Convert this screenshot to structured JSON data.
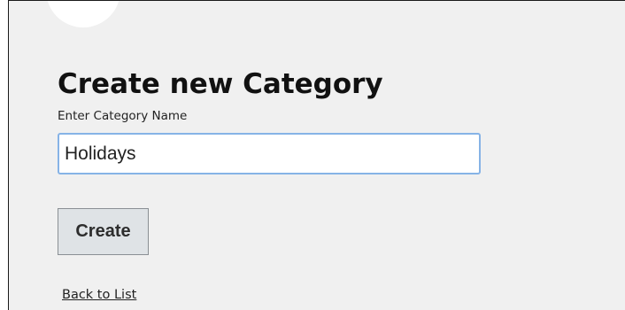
{
  "form": {
    "title": "Create new Category",
    "name_label": "Enter Category Name",
    "name_value": "Holidays",
    "create_label": "Create"
  },
  "nav": {
    "back_link": "Back to List"
  },
  "colors": {
    "page_background": "#f0f0f0",
    "input_focus_border": "#86b3e6",
    "button_background": "#dfe3e6"
  }
}
